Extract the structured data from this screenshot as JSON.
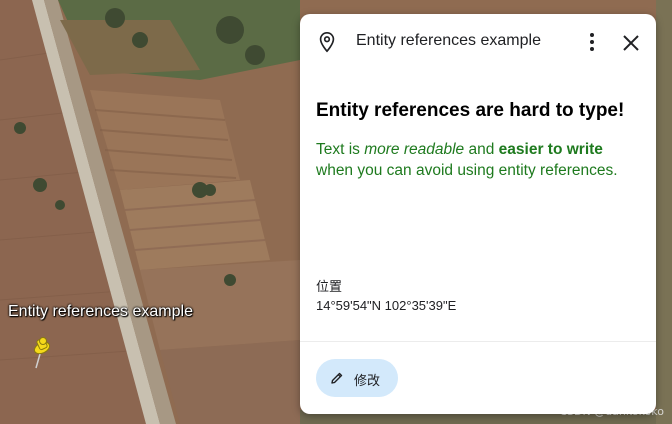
{
  "map": {
    "placemark_label": "Entity references example",
    "watermark": "CSDN @dankokoko"
  },
  "card": {
    "header_title": "Entity references example",
    "description": {
      "heading": "Entity references are hard to type!",
      "text_before": "Text is ",
      "em_text": "more readable",
      "text_middle": " and ",
      "strong_text": "easier to write",
      "text_after": " when you can avoid using entity references."
    },
    "location_label": "位置",
    "coordinates": "14°59'54\"N 102°35'39\"E",
    "edit_label": "修改"
  },
  "colors": {
    "accent_green": "#1e7a1e",
    "edit_button_bg": "#d3e9fb",
    "pin_yellow": "#f5d91a"
  },
  "icons": {
    "header": "place-icon",
    "more": "more-vert-icon",
    "close": "close-icon",
    "edit": "pencil-icon",
    "placemark": "yellow-pushpin-icon"
  }
}
